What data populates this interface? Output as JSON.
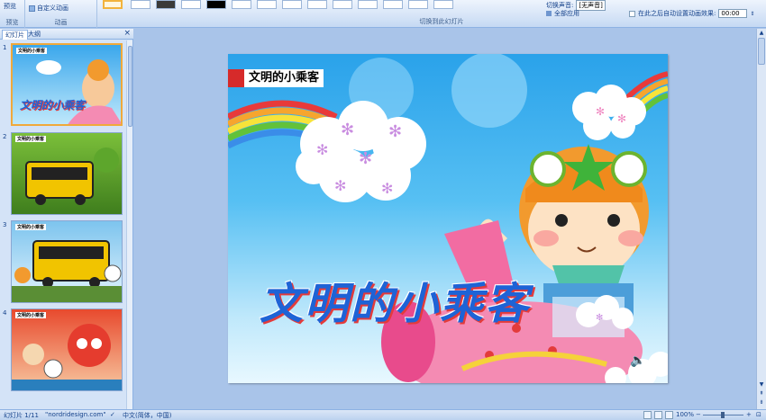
{
  "ribbon": {
    "preview_label": "预览",
    "custom_animation_label": "自定义动画",
    "group_preview": "预览",
    "group_animation": "动画",
    "group_transition": "切换到此幻灯片",
    "sound_label": "切换声音:",
    "sound_value": "[无声音]",
    "apply_all_label": "全部应用",
    "auto_advance_label": "在此之后自动设置动画效果:",
    "auto_advance_time": "00:00"
  },
  "panel": {
    "tab_slides": "幻灯片",
    "tab_outline": "大纲",
    "close_glyph": "×",
    "slides": [
      {
        "number": "1",
        "title": "文明的小乘客"
      },
      {
        "number": "2",
        "title": "文明的小乘客"
      },
      {
        "number": "3",
        "title": "文明的小乘客"
      },
      {
        "number": "4",
        "title": "文明的小乘客"
      }
    ]
  },
  "slide": {
    "title_box": "文明的小乘客",
    "heading": "文明的小乘客"
  },
  "status": {
    "slide_counter": "幻灯片 1/11",
    "theme": "\"nordridesign.com\"",
    "language": "中文(简体，中国)",
    "zoom": "100%"
  },
  "colors": {
    "ribbon_bg": "#d6e4f7",
    "heading_blue": "#1e63d6",
    "heading_shadow_red": "#e33b3b",
    "selected_thumb_border": "#f0a93a"
  }
}
